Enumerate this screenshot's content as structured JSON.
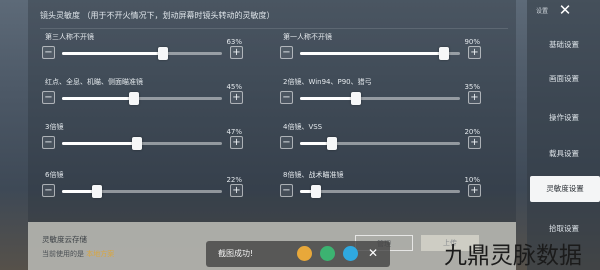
{
  "section_title": "镜头灵敏度 （用于不开火情况下，划动屏幕时镜头转动的灵敏度）",
  "sliders": [
    {
      "label": "第三人称不开镜",
      "value": 63,
      "pct": "63%"
    },
    {
      "label": "第一人称不开镜",
      "value": 90,
      "pct": "90%"
    },
    {
      "label": "红点、全息、机瞄、侧面瞄准镜",
      "value": 45,
      "pct": "45%"
    },
    {
      "label": "2倍镜、Win94、P90、猎弓",
      "value": 35,
      "pct": "35%"
    },
    {
      "label": "3倍镜",
      "value": 47,
      "pct": "47%"
    },
    {
      "label": "4倍镜、VSS",
      "value": 20,
      "pct": "20%"
    },
    {
      "label": "6倍镜",
      "value": 22,
      "pct": "22%"
    },
    {
      "label": "8倍镜、战术瞄准镜",
      "value": 10,
      "pct": "10%"
    }
  ],
  "sidebar": {
    "top_label": "设置",
    "items": [
      {
        "label": "基础设置",
        "active": false
      },
      {
        "label": "画面设置",
        "active": false
      },
      {
        "label": "操作设置",
        "active": false
      },
      {
        "label": "载具设置",
        "active": false
      },
      {
        "label": "灵敏度设置",
        "active": true
      },
      {
        "label": "拾取设置",
        "active": false
      }
    ]
  },
  "cloud": {
    "title": "灵敏度云存储",
    "sub_prefix": "当前使用的是 ",
    "sub_accent": "本地方案",
    "btn1": "管理",
    "btn2": "上传"
  },
  "toast": {
    "text": "截图成功!"
  },
  "watermark": "九鼎灵脉数据",
  "icons": {
    "close": "close-icon",
    "minus": "minus-icon",
    "plus": "plus-icon"
  },
  "colors": {
    "toast_icon1": "#e8a83a",
    "toast_icon2": "#3cb371",
    "toast_icon3": "#2fa9e0"
  }
}
